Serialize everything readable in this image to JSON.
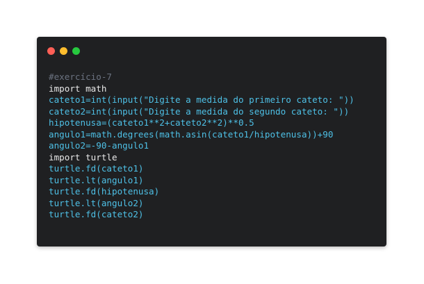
{
  "window": {
    "controls": [
      "close",
      "minimize",
      "maximize"
    ]
  },
  "code": {
    "lines": [
      {
        "parts": [
          {
            "text": "#exercício-7",
            "cls": "comment"
          }
        ]
      },
      {
        "parts": [
          {
            "text": "import",
            "cls": "keyword"
          },
          {
            "text": " math",
            "cls": "plain"
          }
        ]
      },
      {
        "parts": [
          {
            "text": "cateto1=int(input(\"Digite a medida do primeiro cateto: \"))",
            "cls": "blue"
          }
        ]
      },
      {
        "parts": [
          {
            "text": "cateto2=int(input(\"Digite a medida do segundo cateto: \"))",
            "cls": "blue"
          }
        ]
      },
      {
        "parts": [
          {
            "text": "hipotenusa=(cateto1**2+cateto2**2)**0.5",
            "cls": "blue"
          }
        ]
      },
      {
        "parts": [
          {
            "text": "angulo1=math.degrees(math.asin(cateto1/hipotenusa))+90",
            "cls": "blue"
          }
        ]
      },
      {
        "parts": [
          {
            "text": "angulo2=-90-angulo1",
            "cls": "blue"
          }
        ]
      },
      {
        "parts": [
          {
            "text": "import",
            "cls": "keyword"
          },
          {
            "text": " turtle",
            "cls": "plain"
          }
        ]
      },
      {
        "parts": [
          {
            "text": "turtle.fd(cateto1)",
            "cls": "blue"
          }
        ]
      },
      {
        "parts": [
          {
            "text": "turtle.lt(angulo1)",
            "cls": "blue"
          }
        ]
      },
      {
        "parts": [
          {
            "text": "turtle.fd(hipotenusa)",
            "cls": "blue"
          }
        ]
      },
      {
        "parts": [
          {
            "text": "turtle.lt(angulo2)",
            "cls": "blue"
          }
        ]
      },
      {
        "parts": [
          {
            "text": "turtle.fd(cateto2)",
            "cls": "blue"
          }
        ]
      }
    ]
  },
  "colors": {
    "background": "#1f2022",
    "code_blue": "#4ec0e6",
    "comment": "#6b7280",
    "text": "#e8e8e8"
  }
}
